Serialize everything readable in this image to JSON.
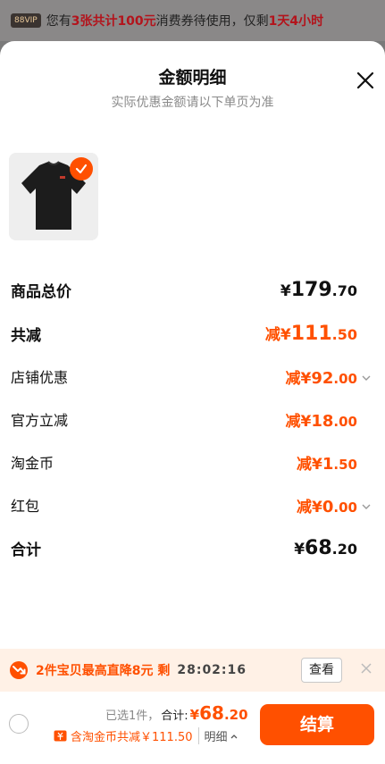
{
  "banner": {
    "badge": "88VIP",
    "text_a": "您有",
    "text_b": "3张共计100元",
    "text_c": "消费券待使用，仅剩",
    "text_d": "1天4小时"
  },
  "sheet": {
    "title": "金额明细",
    "subtitle": "实际优惠金额请以下单页为准"
  },
  "rows": {
    "goods_total": {
      "label": "商品总价",
      "prefix": "¥",
      "int": "179",
      "dec": ".70"
    },
    "total_reduce": {
      "label": "共减",
      "prefix": "减¥",
      "int": "111",
      "dec": ".50"
    },
    "store_discount": {
      "label": "店铺优惠",
      "prefix": "减¥",
      "int": "92",
      "dec": ".00"
    },
    "official_discount": {
      "label": "官方立减",
      "prefix": "减¥",
      "int": "18",
      "dec": ".00"
    },
    "taojinbi": {
      "label": "淘金币",
      "prefix": "减¥",
      "int": "1",
      "dec": ".50"
    },
    "red_packet": {
      "label": "红包",
      "prefix": "减¥",
      "int": "0",
      "dec": ".00"
    },
    "sum": {
      "label": "合计",
      "prefix": "¥",
      "int": "68",
      "dec": ".20"
    }
  },
  "promo": {
    "text": "2件宝贝最高直降8元 剩",
    "timer": "28:02:16",
    "view_label": "查看"
  },
  "bottom": {
    "selected": "已选1件，",
    "total_label": "合计:",
    "total_prefix": "¥",
    "total_int": "68",
    "total_dec": ".20",
    "coin_text": "含淘金币共减￥111.50",
    "detail_label": "明细",
    "checkout_label": "结算"
  },
  "colors": {
    "accent": "#ff5000",
    "promo_bg": "#fff1e6"
  },
  "icons": [
    "close-icon",
    "check-icon",
    "chevron-down-icon",
    "price-drop-icon",
    "coupon-icon",
    "chevron-up-icon"
  ]
}
